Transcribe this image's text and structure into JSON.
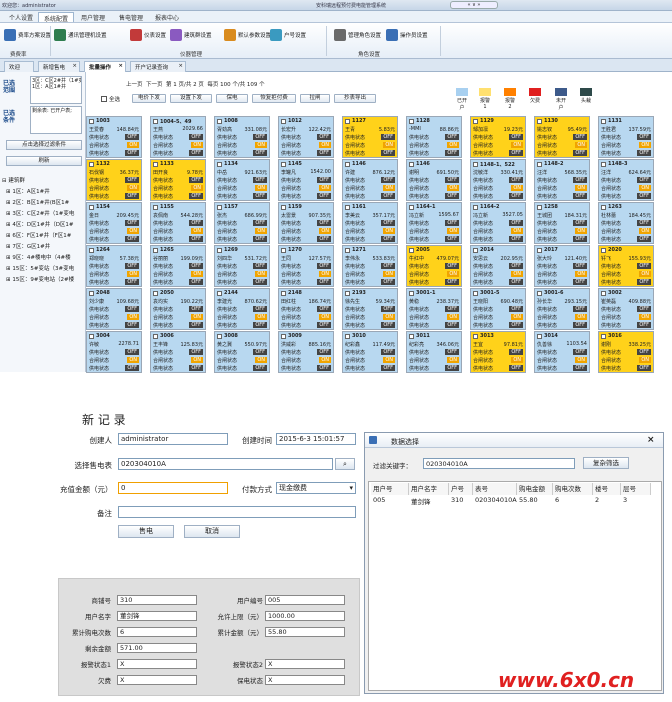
{
  "titlebar": {
    "welcome": "欢迎您：administrator",
    "app_title": "安科瑞远程预付费电能管理系统",
    "window_btn": "«  ∨  »"
  },
  "menu": [
    "个人设置",
    "系统配置",
    "用户管理",
    "售电管理",
    "报表中心"
  ],
  "ribbon": {
    "items": [
      "费率方案设置",
      "通讯管理机设置",
      "仪表设置",
      "建筑群设置",
      "默认参数设置",
      "户号设置",
      "管理角色设置",
      "操作员设置"
    ],
    "groups": [
      "费费率",
      "仪器管理",
      "角色设置"
    ],
    "colors": [
      "#3a6fb5",
      "#2e7d4f",
      "#c23a3a",
      "#8a5ac0",
      "#d98b1e",
      "#3a9ac0",
      "#6a6a6a",
      "#3a6fb5"
    ]
  },
  "tabs": [
    "欢迎",
    "新增售电",
    "批量操作",
    "开户记录查询"
  ],
  "left": {
    "label1": "已选范围",
    "range_text": "3区：C区2#井（1#变电：2#\n1区：A区1#井",
    "label2": "已选条件",
    "cond_text": "剩余表: 已开户表;",
    "btn_select": "点击选择过滤条件",
    "btn_refresh": "刷新",
    "tree": [
      "⊟ 建筑群",
      "⊞ 1区：A区1#井",
      "⊞ 2区：B区1#井(B区1#",
      "⊞ 3区：C区2#井（1#变电",
      "⊞ 4区：D区1#井（D区1#",
      "⊞ 6区：F区1#井（F区1#",
      "⊞ 7区：G区1#井",
      "⊞ 9区：4#楼电中（4#楼",
      "⊞ 15区：5#变站（3#变电",
      "⊞ 15区：9#变电站（2#楼"
    ]
  },
  "toolbar": {
    "pager": "上一页  下一页  第 1 页/共 2 页  每页 100 个/共 109 个",
    "select_all": "全选",
    "buttons": [
      "电价下发",
      "设置下发",
      "保电",
      "恢复拒付费",
      "拉闸",
      "抄表导出"
    ],
    "legend": [
      {
        "label": "已开户",
        "color": "#a8d0f0"
      },
      {
        "label": "报警1",
        "color": "#ffe070"
      },
      {
        "label": "报警2",
        "color": "#ff8000"
      },
      {
        "label": "欠费",
        "color": "#e02020"
      },
      {
        "label": "未开户",
        "color": "#3d5a8a"
      },
      {
        "label": "头裁",
        "color": "#2e4a4a"
      }
    ]
  },
  "grid": {
    "row_labels": [
      "供电状态",
      "合闸状态"
    ],
    "off": "OFF",
    "on": "ON",
    "cards": [
      {
        "id": "1003",
        "name": "王爱春",
        "val": "148.84元",
        "c": "b"
      },
      {
        "id": "1004-5、49",
        "name": "王燕",
        "val": "2029.66",
        "c": "b"
      },
      {
        "id": "1008",
        "name": "胥劲高",
        "val": "331.08元",
        "c": "b"
      },
      {
        "id": "1012",
        "name": "长宏升",
        "val": "122.42元",
        "c": "b"
      },
      {
        "id": "1127",
        "name": "王青",
        "val": "5.83元",
        "c": "y"
      },
      {
        "id": "1128",
        "name": "-MMI",
        "val": "88.86元",
        "c": "b"
      },
      {
        "id": "1129",
        "name": "邹加凛",
        "val": "19.23元",
        "c": "y"
      },
      {
        "id": "1130",
        "name": "姚志钗",
        "val": "95.49元",
        "c": "y"
      },
      {
        "id": "1131",
        "name": "王胜君",
        "val": "137.59元",
        "c": "b"
      },
      {
        "id": "1132",
        "name": "石伐钢",
        "val": "36.37元",
        "c": "y"
      },
      {
        "id": "1133",
        "name": "田开良",
        "val": "9.78元",
        "c": "y"
      },
      {
        "id": "1134",
        "name": "中岳",
        "val": "921.63元",
        "c": "b"
      },
      {
        "id": "1145",
        "name": "李罐凡",
        "val": "1542.00",
        "c": "b"
      },
      {
        "id": "1146",
        "name": "许建",
        "val": "876.12元",
        "c": "b"
      },
      {
        "id": "1146",
        "name": "谢明",
        "val": "691.50元",
        "c": "b"
      },
      {
        "id": "1148-1、522",
        "name": "沈敏洋",
        "val": "330.41元",
        "c": "b"
      },
      {
        "id": "1148-2",
        "name": "汪洋",
        "val": "568.35元",
        "c": "b"
      },
      {
        "id": "1148-3",
        "name": "汪洋",
        "val": "624.64元",
        "c": "b"
      },
      {
        "id": "1154",
        "name": "金日",
        "val": "209.45元",
        "c": "b"
      },
      {
        "id": "1155",
        "name": "袁佩南",
        "val": "544.28元",
        "c": "b"
      },
      {
        "id": "1157",
        "name": "张杰",
        "val": "686.99元",
        "c": "b"
      },
      {
        "id": "1159",
        "name": "太雷景",
        "val": "907.35元",
        "c": "b"
      },
      {
        "id": "1161",
        "name": "李美云",
        "val": "357.17元",
        "c": "b"
      },
      {
        "id": "1164-1",
        "name": "冯立新",
        "val": "1595.67",
        "c": "b"
      },
      {
        "id": "1164-2",
        "name": "冯立新",
        "val": "3527.05",
        "c": "b"
      },
      {
        "id": "1258",
        "name": "王城团",
        "val": "184.31元",
        "c": "b"
      },
      {
        "id": "1263",
        "name": "杜林蕾",
        "val": "184.45元",
        "c": "b"
      },
      {
        "id": "1264",
        "name": "郑晓晓",
        "val": "57.38元",
        "c": "b"
      },
      {
        "id": "1265",
        "name": "谷丽丽",
        "val": "199.09元",
        "c": "b"
      },
      {
        "id": "1269",
        "name": "刘四华",
        "val": "531.72元",
        "c": "b"
      },
      {
        "id": "1270",
        "name": "王同",
        "val": "127.57元",
        "c": "b"
      },
      {
        "id": "1271",
        "name": "李伟永",
        "val": "533.83元",
        "c": "b"
      },
      {
        "id": "2005",
        "name": "牛红中",
        "val": "479.07元",
        "c": "y"
      },
      {
        "id": "2014",
        "name": "安思云",
        "val": "202.95元",
        "c": "b"
      },
      {
        "id": "2017",
        "name": "张大玲",
        "val": "121.40元",
        "c": "b"
      },
      {
        "id": "2020",
        "name": "钎飞",
        "val": "155.93元",
        "c": "y"
      },
      {
        "id": "2048",
        "name": "刘少康",
        "val": "109.68元",
        "c": "b"
      },
      {
        "id": "2050",
        "name": "袁均实",
        "val": "190.22元",
        "c": "b"
      },
      {
        "id": "2144",
        "name": "李建光",
        "val": "870.62元",
        "c": "b"
      },
      {
        "id": "2148",
        "name": "田红柱",
        "val": "186.74元",
        "c": "b"
      },
      {
        "id": "2193",
        "name": "徐先生",
        "val": "59.34元",
        "c": "b"
      },
      {
        "id": "3001-1",
        "name": "黄稳",
        "val": "238.37元",
        "c": "b"
      },
      {
        "id": "3001-5",
        "name": "王晓阳",
        "val": "690.48元",
        "c": "b"
      },
      {
        "id": "3001-6",
        "name": "孙长华",
        "val": "293.15元",
        "c": "b"
      },
      {
        "id": "3002",
        "name": "崔英磊",
        "val": "409.88元",
        "c": "b"
      },
      {
        "id": "3004",
        "name": "许敏",
        "val": "2278.71",
        "c": "b"
      },
      {
        "id": "3006",
        "name": "王丰锋",
        "val": "125.83元",
        "c": "b"
      },
      {
        "id": "3008",
        "name": "黄之冀",
        "val": "550.97元",
        "c": "b"
      },
      {
        "id": "3009",
        "name": "洪威彩",
        "val": "885.16元",
        "c": "b"
      },
      {
        "id": "3010",
        "name": "纪彩鑫",
        "val": "117.49元",
        "c": "b"
      },
      {
        "id": "3011",
        "name": "纪彩亮",
        "val": "346.06元",
        "c": "b"
      },
      {
        "id": "3013",
        "name": "王宜",
        "val": "97.81元",
        "c": "y"
      },
      {
        "id": "3014",
        "name": "仇善徐",
        "val": "1103.54",
        "c": "b"
      },
      {
        "id": "3016",
        "name": "谢刚",
        "val": "338.25元",
        "c": "y"
      }
    ]
  },
  "form": {
    "title": "新 记 录",
    "creator_label": "创建人",
    "creator": "administrator",
    "time_label": "创建时间",
    "time": "2015-6-3 15:01:57",
    "meter_label": "选择售电表",
    "meter": "020304010A",
    "amount_label": "充值金额（元）",
    "amount": "0",
    "pay_label": "付款方式",
    "pay": "现金缴费",
    "note_label": "备注",
    "sell_btn": "售电",
    "cancel_btn": "取消"
  },
  "info": {
    "meter_no_l": "商铺号",
    "meter_no": "310",
    "user_no_l": "用户编号",
    "user_no": "005",
    "user_name_l": "用户名字",
    "user_name": "董剑锋",
    "limit_l": "允许上限（元）",
    "limit": "1000.00",
    "count_l": "累计购电次数",
    "count": "6",
    "total_l": "累计金额（元）",
    "total": "55.80",
    "remain_l": "剩余金额",
    "remain": "571.00",
    "alarm1_l": "报警状态1",
    "alarm1": "X",
    "alarm2_l": "报警状态2",
    "alarm2": "X",
    "owe_l": "欠费",
    "owe": "X",
    "keep_l": "保电状态",
    "keep": "X"
  },
  "dialog": {
    "title": "数据选择",
    "filter_label": "过滤关键字：",
    "filter": "020304010A",
    "filter_btn": "复杂筛选",
    "cols": [
      "用户号",
      "用户名字",
      "户号",
      "表号",
      "购电金额",
      "购电次数",
      "楼号",
      "层号"
    ],
    "row": [
      "005",
      "董剑锋",
      "310",
      "020304010A",
      "55.80",
      "6",
      "2",
      "3"
    ]
  },
  "watermark": "www.6x0.cn"
}
